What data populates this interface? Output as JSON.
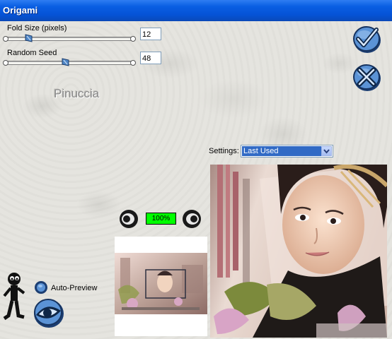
{
  "window": {
    "title": "Origami"
  },
  "params": [
    {
      "label": "Fold Size (pixels)",
      "value": "12",
      "fraction": 0.16
    },
    {
      "label": "Random Seed",
      "value": "48",
      "fraction": 0.47
    }
  ],
  "watermark": "Pinuccia",
  "buttons": {
    "ok": "checkmark-icon",
    "cancel": "cancel-x-icon"
  },
  "settings": {
    "label": "Settings:",
    "selected": "Last Used"
  },
  "zoom": {
    "value": "100%"
  },
  "auto_preview": {
    "label": "Auto-Preview"
  },
  "colors": {
    "titlebar": "#0553d6",
    "zoom_bg": "#00ff00",
    "accent_blue": "#3b73b8"
  }
}
